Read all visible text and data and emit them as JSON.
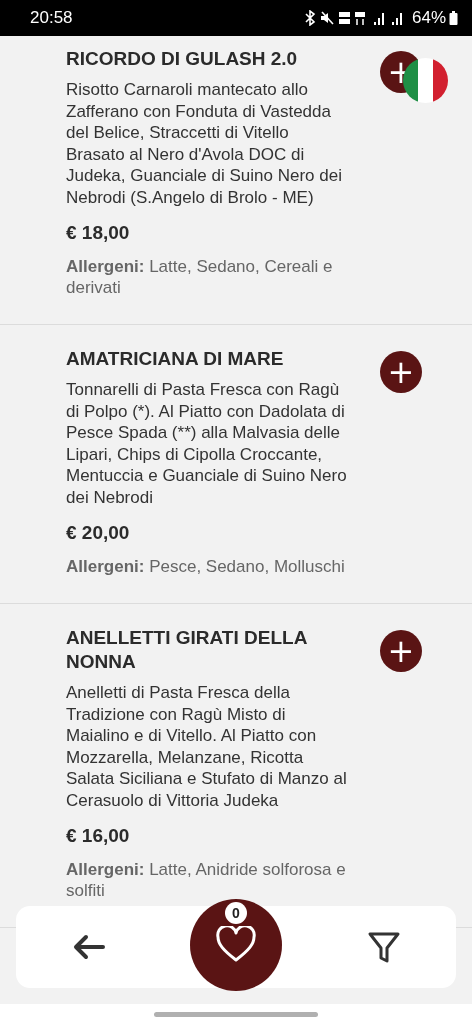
{
  "status_bar": {
    "time": "20:58",
    "battery": "64%"
  },
  "dishes": [
    {
      "name": "RICORDO DI GULASH 2.0",
      "description": "Risotto Carnaroli mantecato allo Zafferano con Fonduta di Vastedda del Belice, Straccetti di Vitello Brasato al Nero d'Avola DOC di Judeka, Guanciale di Suino Nero dei Nebrodi (S.Angelo di Brolo - ME)",
      "price": "€ 18,00",
      "allergens": "**Allergeni:** Latte, Sedano, Cereali e derivati",
      "add_symbol": "+"
    },
    {
      "name": "AMATRICIANA DI MARE",
      "description": "Tonnarelli di Pasta Fresca con Ragù di Polpo (*). Al Piatto con Dadolata di Pesce Spada (**) alla Malvasia delle Lipari, Chips di Cipolla Croccante, Mentuccia e Guanciale di Suino Nero dei Nebrodi",
      "price": "€ 20,00",
      "allergens": "**Allergeni:** Pesce, Sedano, Molluschi",
      "add_symbol": "+"
    },
    {
      "name": "ANELLETTI GIRATI DELLA NONNA",
      "description": "Anelletti di Pasta Fresca della Tradizione con Ragù Misto di Maialino e di Vitello. Al Piatto con Mozzarella, Melanzane, Ricotta Salata Siciliana e Stufato di Manzo al Cerasuolo di Vittoria Judeka",
      "price": "€ 16,00",
      "allergens": "**Allergeni:** Latte, Anidride solforosa e solfiti",
      "add_symbol": "+"
    }
  ],
  "bottom_nav": {
    "favorites_count": "0"
  }
}
